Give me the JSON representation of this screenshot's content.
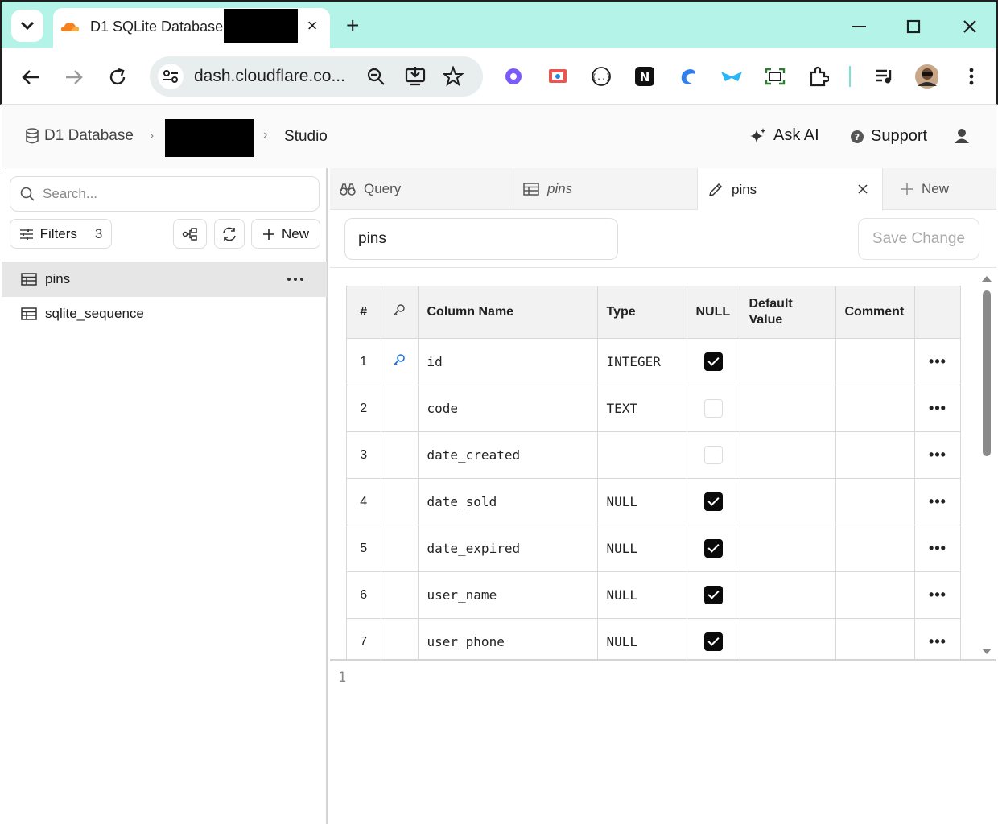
{
  "browser": {
    "tab_title": "D1 SQLite Database |",
    "url": "dash.cloudflare.co...",
    "new_tab_glyph": "+",
    "close_tab_glyph": "×"
  },
  "header": {
    "breadcrumb_root": "D1 Database",
    "breadcrumb_current": "Studio",
    "ask_ai": "Ask AI",
    "support": "Support"
  },
  "sidebar": {
    "search_placeholder": "Search...",
    "filters_label": "Filters",
    "filters_count": "3",
    "new_label": "New",
    "tables": [
      {
        "name": "pins",
        "selected": true
      },
      {
        "name": "sqlite_sequence",
        "selected": false
      }
    ]
  },
  "tabs": [
    {
      "label": "Query"
    },
    {
      "label": "pins"
    },
    {
      "label": "pins"
    },
    {
      "label": "New"
    }
  ],
  "editor": {
    "table_name": "pins",
    "save_label": "Save Change",
    "columns": [
      "#",
      "Column Name",
      "Type",
      "NULL",
      "Default Value",
      "Comment"
    ],
    "rows": [
      {
        "num": "1",
        "pk": true,
        "name": "id",
        "type": "INTEGER",
        "null": true
      },
      {
        "num": "2",
        "pk": false,
        "name": "code",
        "type": "TEXT",
        "null": false
      },
      {
        "num": "3",
        "pk": false,
        "name": "date_created",
        "type": "",
        "null": false
      },
      {
        "num": "4",
        "pk": false,
        "name": "date_sold",
        "type": "NULL",
        "null": true
      },
      {
        "num": "5",
        "pk": false,
        "name": "date_expired",
        "type": "NULL",
        "null": true
      },
      {
        "num": "6",
        "pk": false,
        "name": "user_name",
        "type": "NULL",
        "null": true
      },
      {
        "num": "7",
        "pk": false,
        "name": "user_phone",
        "type": "NULL",
        "null": true
      }
    ],
    "row_menu": "•••",
    "sql_line_number": "1"
  }
}
